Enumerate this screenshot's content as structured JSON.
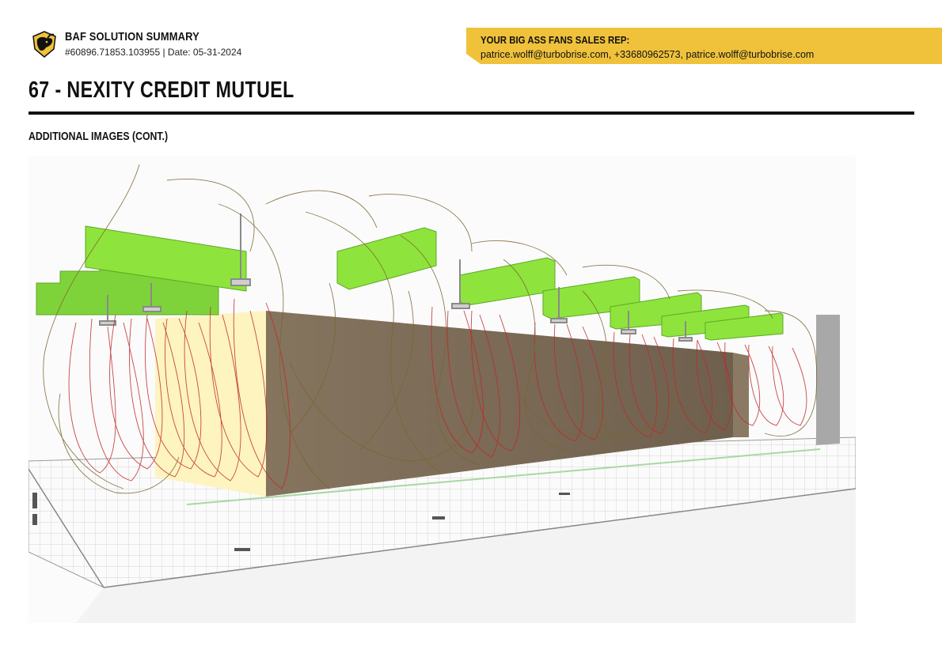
{
  "header": {
    "title": "BAF SOLUTION SUMMARY",
    "meta": "#60896.71853.103955 | Date: 05-31-2024"
  },
  "sales_rep": {
    "title": "YOUR BIG ASS FANS SALES REP:",
    "contact": "patrice.wolff@turbobrise.com, +33680962573, patrice.wolff@turbobrise.com"
  },
  "project": {
    "title": "67 - NEXITY CREDIT MUTUEL"
  },
  "section": {
    "title": "ADDITIONAL IMAGES (CONT.)"
  },
  "colors": {
    "accent": "#f0c23c",
    "fan_block": "#8ee43c",
    "streamline": "#c0282a",
    "streamline_dark": "#6b5a2a",
    "wall": "#7a6a55"
  },
  "icons": {
    "logo": "baf-bull-logo-icon"
  }
}
